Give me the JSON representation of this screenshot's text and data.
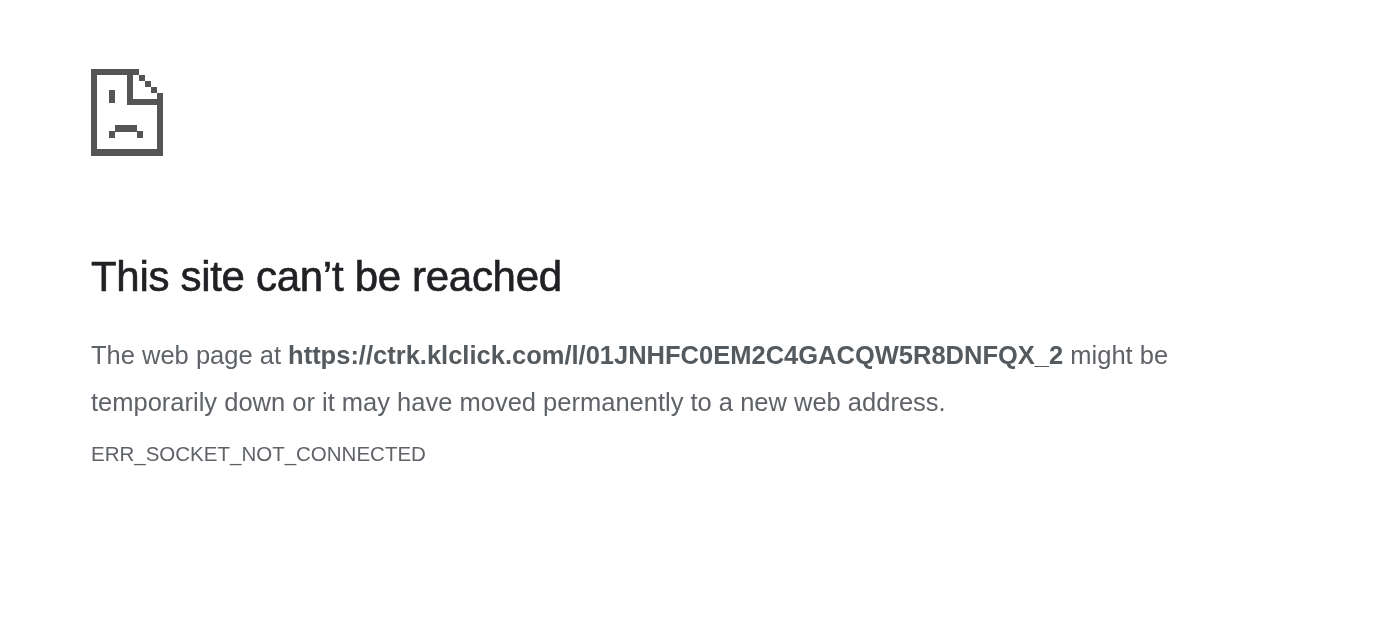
{
  "heading": "This site can’t be reached",
  "message": "The web page at **https://ctrk.klclick.com/l/01JNHFC0EM2C4GACQW5R8DNFQX_2** might be temporarily down or it may have moved permanently to a new web address.",
  "error_code": "ERR_SOCKET_NOT_CONNECTED"
}
